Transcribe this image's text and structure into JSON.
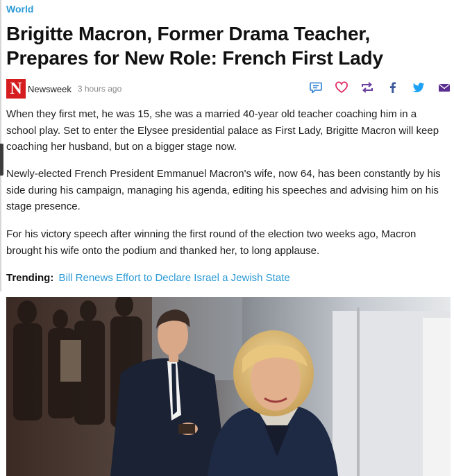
{
  "article": {
    "category": "World",
    "title": "Brigitte Macron, Former Drama Teacher, Prepares for New Role: French First Lady",
    "source_logo": "N",
    "source": "Newsweek",
    "time": "3 hours ago",
    "paragraphs": [
      "When they first met, he was 15, she was a married 40-year old teacher coaching him in a school play. Set to enter the Elysee presidential palace as First Lady, Brigitte Macron will keep coaching her husband, but on a bigger stage now.",
      "Newly-elected French President Emmanuel Macron's wife, now 64, has been constantly by his side during his campaign, managing his agenda, editing his speeches and advising him on his stage presence.",
      "For his victory speech after winning the first round of the election two weeks ago, Macron brought his wife onto the podium and thanked her, to long applause."
    ],
    "trending": {
      "label": "Trending:",
      "link": "Bill Renews Effort to Declare Israel a Jewish State"
    }
  },
  "actions": [
    {
      "name": "comment-icon",
      "color": "#2a7fd4"
    },
    {
      "name": "heart-icon",
      "color": "#e0245e"
    },
    {
      "name": "share-icon",
      "color": "#6b3fa0"
    },
    {
      "name": "facebook-icon",
      "color": "#3b5998"
    },
    {
      "name": "twitter-icon",
      "color": "#1da1f2"
    },
    {
      "name": "mail-icon",
      "color": "#5b2d90"
    }
  ],
  "colors": {
    "accent": "#2a9ad6",
    "newsweek_red": "#d51d20"
  }
}
